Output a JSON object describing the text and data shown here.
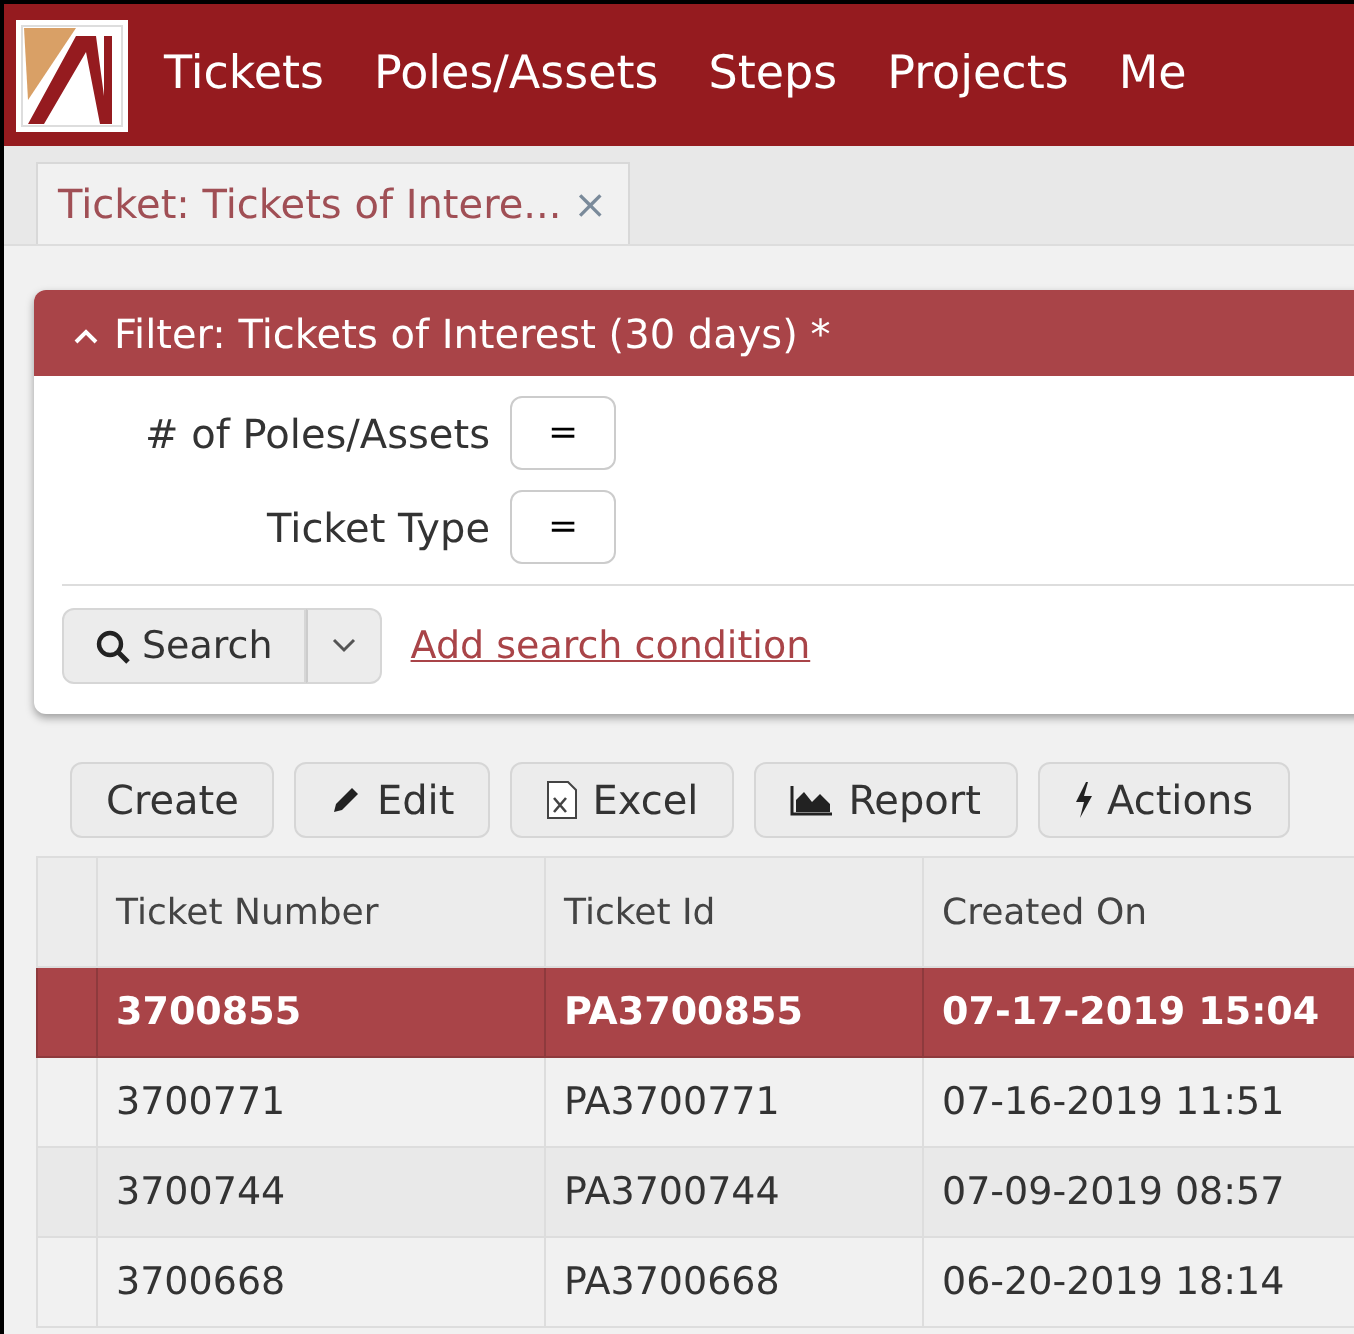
{
  "nav": {
    "items": [
      "Tickets",
      "Poles/Assets",
      "Steps",
      "Projects",
      "Me"
    ]
  },
  "tabs": [
    {
      "label": "Ticket: Tickets of Intere...",
      "close": "×",
      "selected": true
    }
  ],
  "filter": {
    "title": "Filter: Tickets of Interest (30 days) *",
    "expanded": true,
    "conditions": [
      {
        "label": "# of Poles/Assets",
        "operator": "="
      },
      {
        "label": "Ticket Type",
        "operator": "="
      }
    ],
    "search_button": "Search",
    "add_link": "Add search condition"
  },
  "toolbar": [
    {
      "label": "Create",
      "kind": "plain"
    },
    {
      "label": "Edit",
      "kind": "edit"
    },
    {
      "label": "Excel",
      "kind": "export"
    },
    {
      "label": "Report",
      "kind": "report"
    },
    {
      "label": "Actions",
      "kind": "actions"
    }
  ],
  "table": {
    "columns": [
      "Ticket Number",
      "Ticket Id",
      "Created On"
    ],
    "rows": [
      {
        "cells": [
          "3700855",
          "PA3700855",
          "07-17-2019 15:04"
        ],
        "selected": true
      },
      {
        "cells": [
          "3700771",
          "PA3700771",
          "07-16-2019 11:51"
        ],
        "selected": false
      },
      {
        "cells": [
          "3700744",
          "PA3700744",
          "07-09-2019 08:57"
        ],
        "selected": false
      },
      {
        "cells": [
          "3700668",
          "PA3700668",
          "06-20-2019 18:14"
        ],
        "selected": false
      }
    ]
  }
}
